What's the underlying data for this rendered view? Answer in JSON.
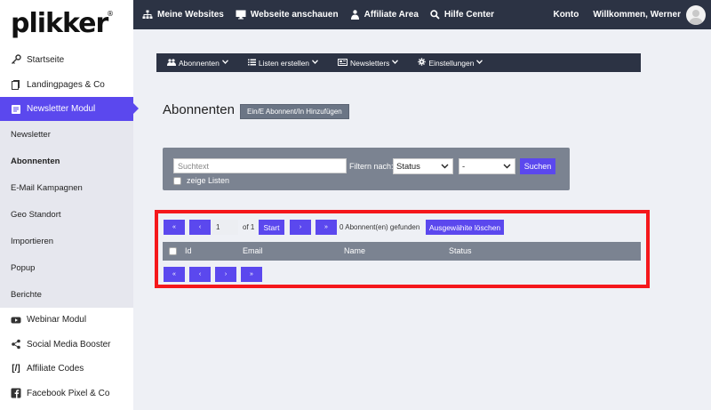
{
  "brand": {
    "logo_text": "plikker",
    "reg": "®"
  },
  "topnav": {
    "items": [
      {
        "label": "Meine Websites",
        "icon": "sitemap-icon"
      },
      {
        "label": "Webseite anschauen",
        "icon": "monitor-icon"
      },
      {
        "label": "Affiliate Area",
        "icon": "users-icon"
      },
      {
        "label": "Hilfe Center",
        "icon": "search-icon"
      }
    ],
    "konto": "Konto",
    "welcome": "Willkommen, Werner"
  },
  "sidebar": {
    "items_top": [
      {
        "label": "Startseite",
        "icon": "key-icon"
      },
      {
        "label": "Landingpages & Co",
        "icon": "pages-icon"
      }
    ],
    "active": {
      "label": "Newsletter Modul",
      "icon": "newsletter-icon"
    },
    "sub_items": [
      {
        "label": "Newsletter",
        "bold": false
      },
      {
        "label": "Abonnenten",
        "bold": true
      },
      {
        "label": "E-Mail Kampagnen",
        "bold": false
      },
      {
        "label": "Geo Standort",
        "bold": false
      },
      {
        "label": "Importieren",
        "bold": false
      },
      {
        "label": "Popup",
        "bold": false
      },
      {
        "label": "Berichte",
        "bold": false
      }
    ],
    "items_bottom": [
      {
        "label": "Webinar Modul",
        "icon": "youtube-icon"
      },
      {
        "label": "Social Media Booster",
        "icon": "share-icon"
      },
      {
        "label": "Affiliate Codes",
        "icon": "code-icon"
      },
      {
        "label": "Facebook Pixel & Co",
        "icon": "facebook-icon"
      }
    ]
  },
  "submenu": {
    "items": [
      {
        "label": "Abonnenten",
        "icon": "users-icon"
      },
      {
        "label": "Listen erstellen",
        "icon": "list-icon"
      },
      {
        "label": "Newsletters",
        "icon": "newspaper-icon"
      },
      {
        "label": "Einstellungen",
        "icon": "gear-icon"
      }
    ]
  },
  "page": {
    "title": "Abonnenten",
    "add_button": "Ein/E Abonnent/In Hinzufügen"
  },
  "filter": {
    "search_placeholder": "Suchtext",
    "label": "Filtern nach:",
    "status_select": "Status",
    "dash_select": "-",
    "search_button": "Suchen",
    "show_lists": "zeige Listen"
  },
  "pagination": {
    "first": "«",
    "prev": "‹",
    "page_value": "1",
    "of_text": "of 1",
    "start": "Start",
    "next": "›",
    "last": "»",
    "found": "0 Abonnent(en) gefunden",
    "delete_selected": "Ausgewähite löschen"
  },
  "table": {
    "columns": [
      "Id",
      "Email",
      "Name",
      "Status"
    ]
  },
  "colors": {
    "accent": "#5b48ee",
    "dark": "#2c3344",
    "highlight": "#f5171b"
  }
}
